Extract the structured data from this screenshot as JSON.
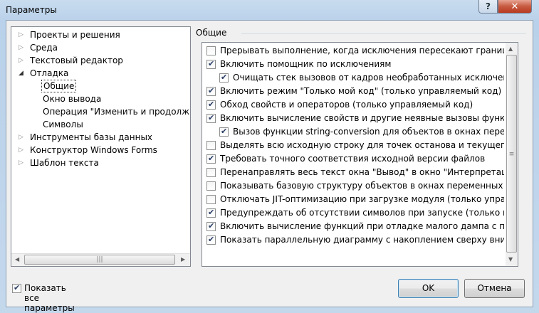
{
  "window": {
    "title": "Параметры",
    "help_label": "?",
    "close_label": "✕"
  },
  "tree": {
    "items": [
      {
        "label": "Проекты и решения",
        "arrow": "▷"
      },
      {
        "label": "Среда",
        "arrow": "▷"
      },
      {
        "label": "Текстовый редактор",
        "arrow": "▷"
      },
      {
        "label": "Отладка",
        "arrow": "◢"
      },
      {
        "label": "Общие"
      },
      {
        "label": "Окно вывода"
      },
      {
        "label": "Операция \"Изменить и продолжить\""
      },
      {
        "label": "Символы"
      },
      {
        "label": "Инструменты базы данных",
        "arrow": "▷"
      },
      {
        "label": "Конструктор Windows Forms",
        "arrow": "▷"
      },
      {
        "label": "Шаблон текста",
        "arrow": "▷"
      }
    ],
    "hscroll": {
      "left_arrow": "◀",
      "right_arrow": "▶",
      "grip": "|||"
    }
  },
  "group": {
    "title": "Общие"
  },
  "options": [
    {
      "label": "Прерывать выполнение, когда исключения пересекают границу домена приложения",
      "checked": false
    },
    {
      "label": "Включить помощник по исключениям",
      "checked": true
    },
    {
      "label": "Очищать стек вызовов от кадров необработанных исключений",
      "checked": true
    },
    {
      "label": "Включить режим \"Только мой код\" (только управляемый код)",
      "checked": true
    },
    {
      "label": "Обход свойств и операторов (только управляемый код)",
      "checked": true
    },
    {
      "label": "Включить вычисление свойств и другие неявные вызовы функций",
      "checked": true
    },
    {
      "label": "Вызов функции string-conversion для объектов в окнах переменных",
      "checked": true
    },
    {
      "label": "Выделять всю исходную строку для точек останова и текущего оператора",
      "checked": false
    },
    {
      "label": "Требовать точного соответствия исходной версии файлов",
      "checked": true
    },
    {
      "label": "Перенаправлять весь текст окна \"Вывод\" в окно \"Интерпретация\"",
      "checked": false
    },
    {
      "label": "Показывать базовую структуру объектов в окнах переменных",
      "checked": false
    },
    {
      "label": "Отключать JIT-оптимизацию при загрузке модуля (только управляемый код)",
      "checked": false
    },
    {
      "label": "Предупреждать об отсутствии символов при запуске (только машинный код)",
      "checked": true
    },
    {
      "label": "Включить вычисление функций при отладке малого дампа с помощью",
      "checked": true
    },
    {
      "label": "Показать параллельную диаграмму с накоплением сверху вниз",
      "checked": true
    }
  ],
  "vscroll": {
    "up_arrow": "▲",
    "down_arrow": "▼",
    "grip": "≡"
  },
  "footer": {
    "show_all_label": "Показать все параметры",
    "show_all_checked": true,
    "ok_label": "OK",
    "cancel_label": "Отмена"
  }
}
